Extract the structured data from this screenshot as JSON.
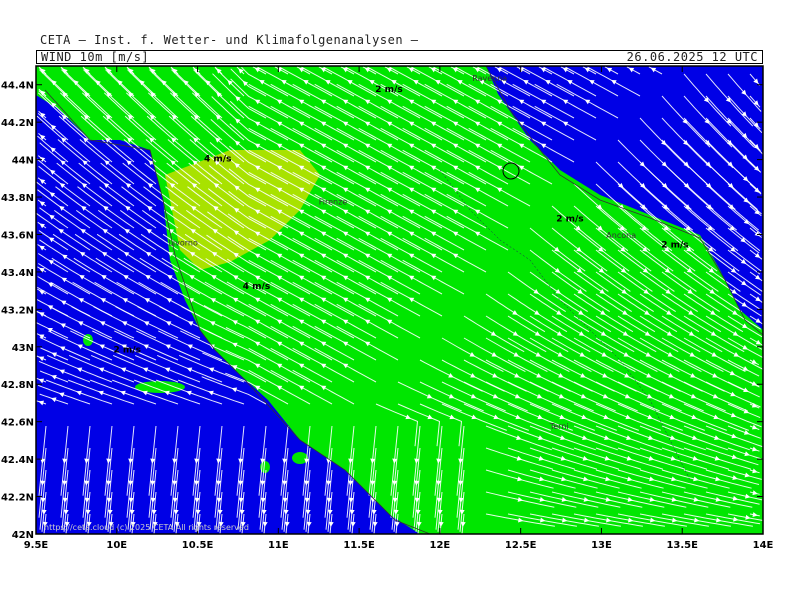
{
  "header": {
    "title": "CETA — Inst. f. Wetter- und Klimafolgenanalysen —",
    "field": "WIND_10m_[m/s]",
    "datetime": "26.06.2025 12 UTC"
  },
  "map": {
    "lon_range": [
      9.5,
      14.0
    ],
    "lat_range": [
      42.0,
      44.5
    ],
    "lat_ticks": [
      "44.4N",
      "44.2N",
      "44N",
      "43.8N",
      "43.6N",
      "43.4N",
      "43.2N",
      "43N",
      "42.8N",
      "42.6N",
      "42.4N",
      "42.2N",
      "42N"
    ],
    "lat_values": [
      44.4,
      44.2,
      44.0,
      43.8,
      43.6,
      43.4,
      43.2,
      43.0,
      42.8,
      42.6,
      42.4,
      42.2,
      42.0
    ],
    "lon_ticks": [
      "9.5E",
      "10E",
      "10.5E",
      "11E",
      "11.5E",
      "12E",
      "12.5E",
      "13E",
      "13.5E",
      "14E"
    ],
    "lon_values": [
      9.5,
      10.0,
      10.5,
      11.0,
      11.5,
      12.0,
      12.5,
      13.0,
      13.5,
      14.0
    ],
    "colors": {
      "low": "#0000e6",
      "mid": "#00e600",
      "high": "#f0e000",
      "stream": "#ffffff"
    },
    "speed_labels": [
      {
        "text": "2 m/s",
        "lon": 11.6,
        "lat": 44.36
      },
      {
        "text": "4 m/s",
        "lon": 10.54,
        "lat": 43.99
      },
      {
        "text": "4 m/s",
        "lon": 10.78,
        "lat": 43.31
      },
      {
        "text": "2 m/s",
        "lon": 12.72,
        "lat": 43.67
      },
      {
        "text": "2 m/s",
        "lon": 13.37,
        "lat": 43.53
      },
      {
        "text": "2 m/s",
        "lon": 9.98,
        "lat": 42.97
      }
    ],
    "cities": [
      {
        "name": "Ravenna",
        "lon": 12.2,
        "lat": 44.42
      },
      {
        "name": "Firenze",
        "lon": 11.25,
        "lat": 43.76
      },
      {
        "name": "Livorno",
        "lon": 10.32,
        "lat": 43.54
      },
      {
        "name": "Ancona",
        "lon": 13.03,
        "lat": 43.58
      },
      {
        "name": "Terni",
        "lon": 12.68,
        "lat": 42.56
      }
    ],
    "credit": "https://ceta.cloud  (c) 2025  CETA  All rights reserved"
  }
}
